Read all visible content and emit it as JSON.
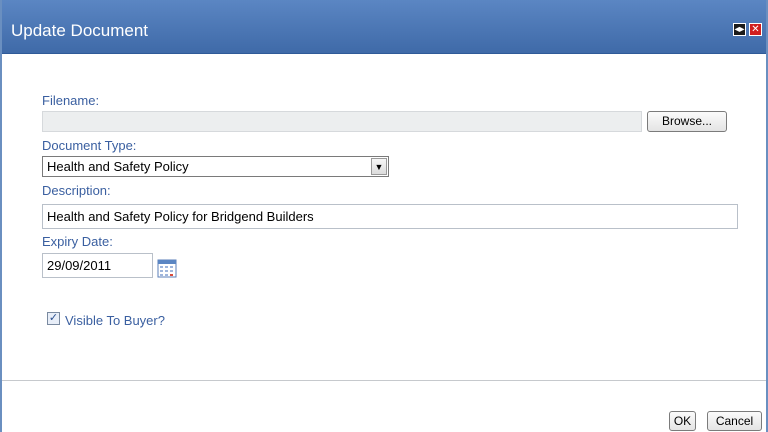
{
  "dialog": {
    "title": "Update Document"
  },
  "form": {
    "filename_label": "Filename:",
    "filename_value": "",
    "browse_label": "Browse...",
    "doc_type_label": "Document Type:",
    "doc_type_value": "Health and Safety Policy",
    "description_label": "Description:",
    "description_value": "Health and Safety Policy for Bridgend Builders",
    "expiry_label": "Expiry Date:",
    "expiry_value": "29/09/2011",
    "visible_label": "Visible To Buyer?",
    "visible_checked": true
  },
  "footer": {
    "ok_label": "OK",
    "cancel_label": "Cancel"
  },
  "icons": {
    "resize": "resize-arrows-icon",
    "close": "close-icon",
    "calendar": "calendar-icon",
    "dropdown": "chevron-down-icon"
  },
  "colors": {
    "titlebar": "#4a76b6",
    "label": "#3a5fa0",
    "close_button": "#d01e1e"
  }
}
